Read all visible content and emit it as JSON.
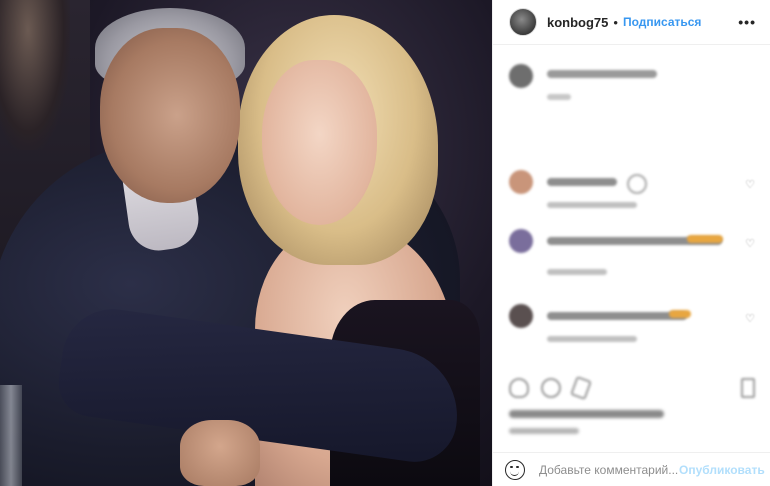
{
  "post": {
    "username": "konbog75",
    "separator": "•",
    "follow_label": "Подписаться",
    "more_label": "•••"
  },
  "comments": [
    {
      "avatar_color": "#6e6e6e",
      "name_color": "#9a9a9a",
      "text_color": "#c7c7c7"
    },
    {
      "avatar_color": "#c9957a",
      "name_color": "#8e8e8e",
      "text_color": "#c0c0c0"
    },
    {
      "avatar_color": "#7a6e9c",
      "name_color": "#8e8e8e",
      "text_color": "#c0c0c0"
    },
    {
      "avatar_color": "#5a5050",
      "name_color": "#8e8e8e",
      "text_color": "#c0c0c0"
    }
  ],
  "add_comment": {
    "placeholder": "Добавьте комментарий...",
    "publish_label": "Опубликовать"
  },
  "colors": {
    "accent": "#3897f0",
    "publish_disabled": "#b2dffc"
  }
}
